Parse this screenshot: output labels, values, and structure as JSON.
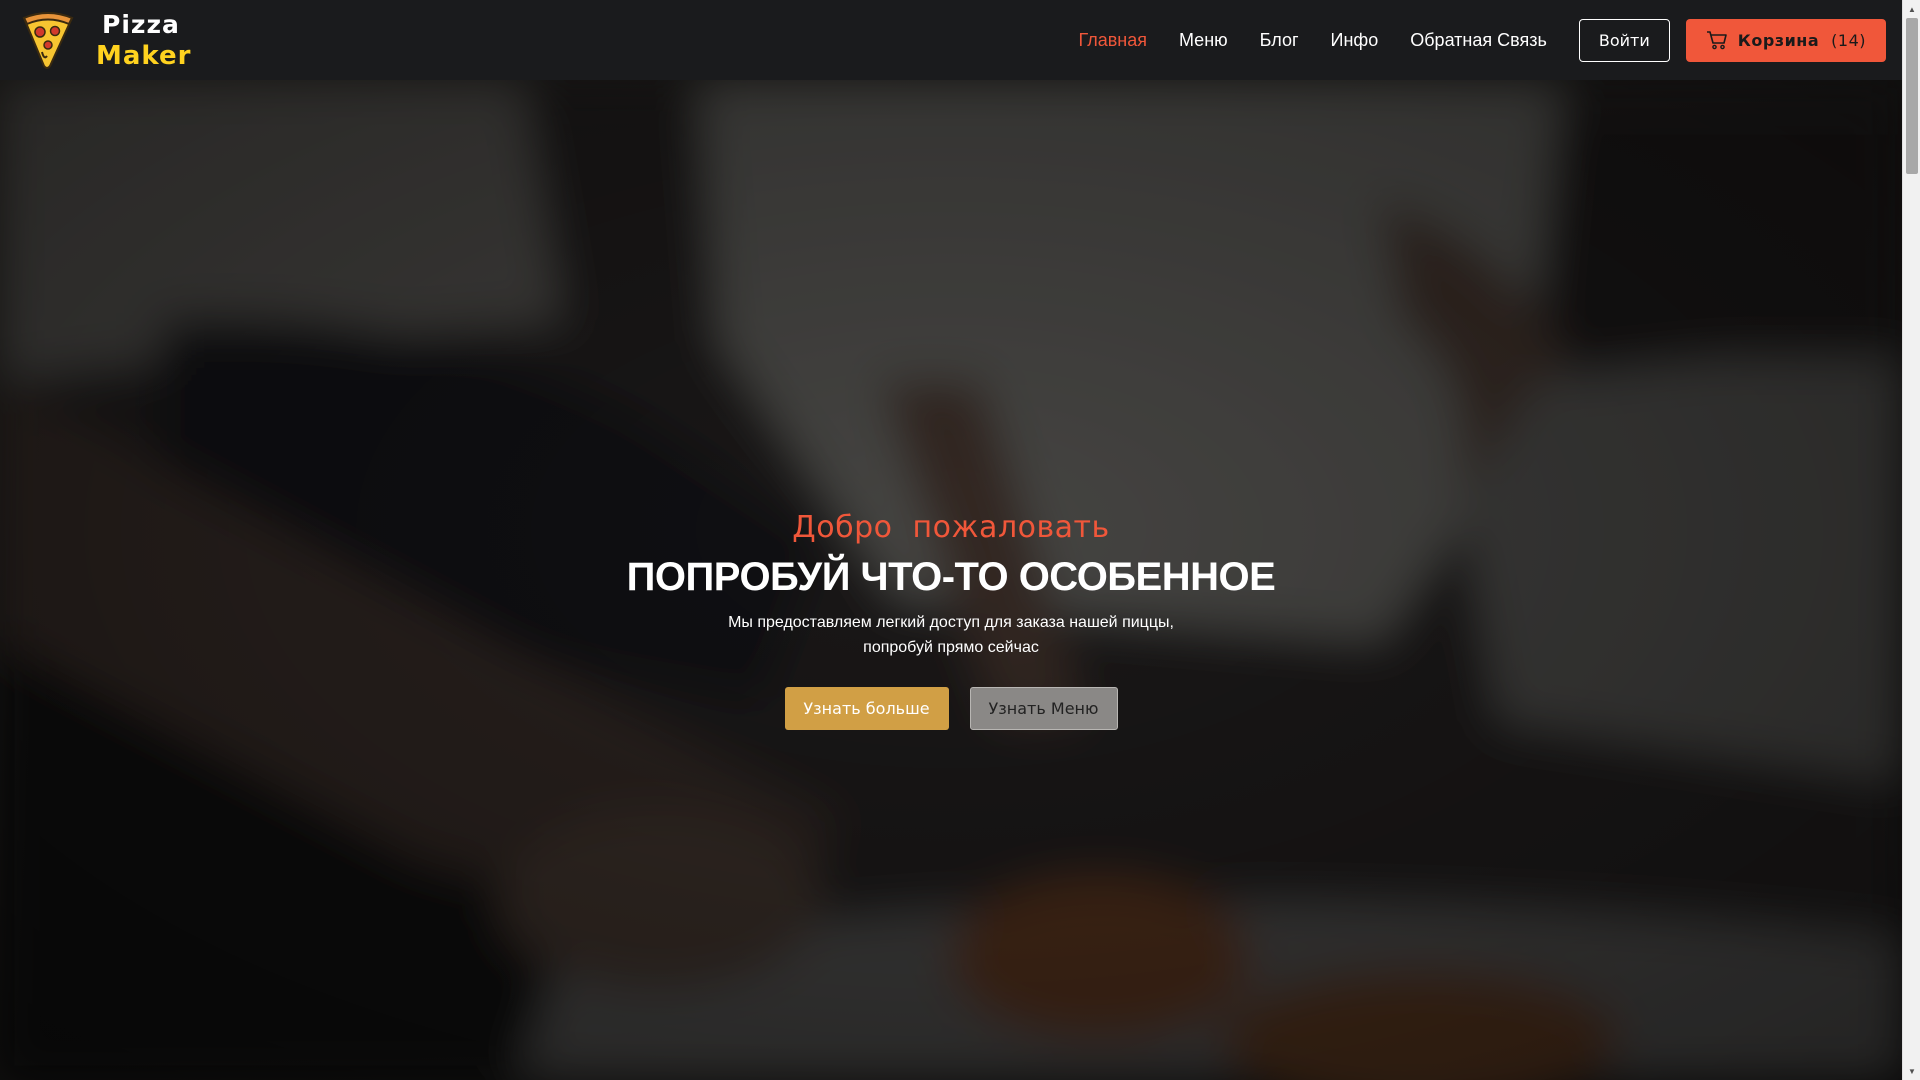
{
  "brand": {
    "name_line1": "Pizza",
    "name_line2": "Maker",
    "logo_icon": "pizza-slice-icon",
    "accent_color": "#f0573a",
    "logo_color": "#ffd21f"
  },
  "nav": {
    "items": [
      {
        "label": "Главная",
        "active": true
      },
      {
        "label": "Меню",
        "active": false
      },
      {
        "label": "Блог",
        "active": false
      },
      {
        "label": "Инфо",
        "active": false
      },
      {
        "label": "Обратная Связь",
        "active": false
      }
    ],
    "login_label": "Войти",
    "cart_label": "Корзина",
    "cart_count": "(14)",
    "cart_icon": "cart-icon"
  },
  "hero": {
    "welcome": "Добро  пожаловать",
    "title": "ПОПРОБУЙ ЧТО-ТО ОСОБЕННОЕ",
    "description_line1": "Мы предоставляем легкий доступ для заказа нашей пиццы,",
    "description_line2": "попробуй прямо сейчас",
    "primary_button": "Узнать больше",
    "secondary_button": "Узнать Меню",
    "primary_color": "#d19f45"
  }
}
